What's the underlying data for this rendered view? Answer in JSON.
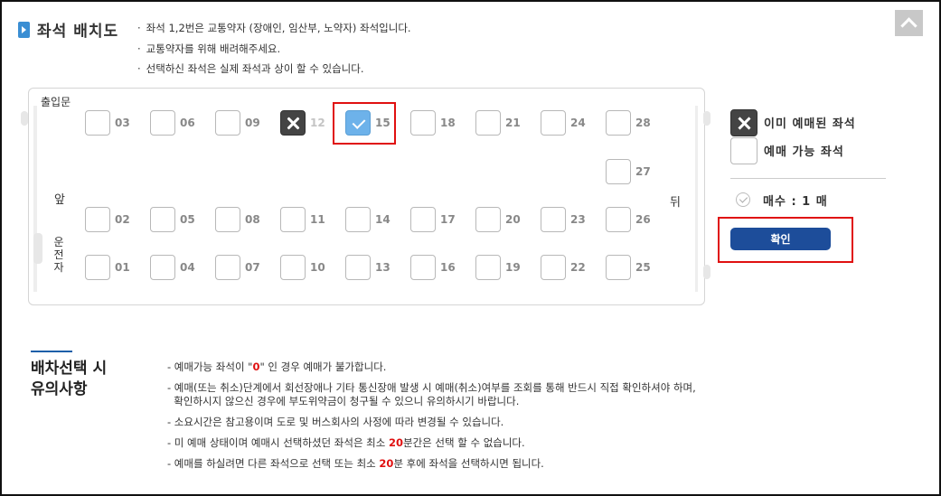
{
  "title": "좌석 배치도",
  "notes": [
    "좌석 1,2번은 교통약자 (장애인, 임산부, 노약자) 좌석입니다.",
    "교통약자를 위해 배려해주세요.",
    "선택하신 좌석은 실제 좌석과 상이 할 수 있습니다."
  ],
  "bus": {
    "entrance": "출입문",
    "front": "앞",
    "back": "뒤",
    "driver": "운전자"
  },
  "seats": [
    {
      "num": "03",
      "status": "available"
    },
    {
      "num": "06",
      "status": "available"
    },
    {
      "num": "09",
      "status": "available"
    },
    {
      "num": "12",
      "status": "sold"
    },
    {
      "num": "15",
      "status": "selected"
    },
    {
      "num": "18",
      "status": "available"
    },
    {
      "num": "21",
      "status": "available"
    },
    {
      "num": "24",
      "status": "available"
    },
    {
      "num": "28",
      "status": "available"
    },
    {
      "num": "27",
      "status": "available"
    },
    {
      "num": "02",
      "status": "available"
    },
    {
      "num": "05",
      "status": "available"
    },
    {
      "num": "08",
      "status": "available"
    },
    {
      "num": "11",
      "status": "available"
    },
    {
      "num": "14",
      "status": "available"
    },
    {
      "num": "17",
      "status": "available"
    },
    {
      "num": "20",
      "status": "available"
    },
    {
      "num": "23",
      "status": "available"
    },
    {
      "num": "26",
      "status": "available"
    },
    {
      "num": "01",
      "status": "available"
    },
    {
      "num": "04",
      "status": "available"
    },
    {
      "num": "07",
      "status": "available"
    },
    {
      "num": "10",
      "status": "available"
    },
    {
      "num": "13",
      "status": "available"
    },
    {
      "num": "16",
      "status": "available"
    },
    {
      "num": "19",
      "status": "available"
    },
    {
      "num": "22",
      "status": "available"
    },
    {
      "num": "25",
      "status": "available"
    }
  ],
  "legend": {
    "sold_label": "이미 예매된 좌석",
    "available_label": "예매 가능 좌석"
  },
  "count": {
    "label": "매수 : 1 매"
  },
  "confirm_label": "확인",
  "caution": {
    "title_line1": "배차선택 시",
    "title_line2": "유의사항",
    "items": [
      {
        "pre": "- 예매가능 좌석이 \"",
        "hl": "0",
        "post": "\" 인 경우 예매가 불가합니다."
      },
      {
        "pre": "- 예매(또는 취소)단계에서 회선장애나 기타 통신장애 발생 시 예매(취소)여부를 조회를 통해 반드시 직접 확인하셔야 하며,",
        "hl": "",
        "post": ""
      },
      {
        "pre": "  확인하시지 않으신 경우에 부도위약금이 청구될 수 있으니 유의하시기 바랍니다.",
        "hl": "",
        "post": ""
      },
      {
        "pre": "- 소요시간은 참고용이며 도로 및 버스회사의 사정에 따라 변경될 수 있습니다.",
        "hl": "",
        "post": ""
      },
      {
        "pre": "- 미 예매 상태이며 예매시 선택하셨던 좌석은 최소 ",
        "hl": "20",
        "post": "분간은 선택 할 수 없습니다."
      },
      {
        "pre": "- 예매를 하실려면 다른 좌석으로 선택 또는 최소 ",
        "hl": "20",
        "post": "분 후에 좌석을 선택하시면 됩니다."
      }
    ]
  },
  "colors": {
    "accent": "#1d4d9a",
    "highlight": "#e01010",
    "selected_seat": "#6db2ea",
    "sold_seat": "#444444"
  }
}
